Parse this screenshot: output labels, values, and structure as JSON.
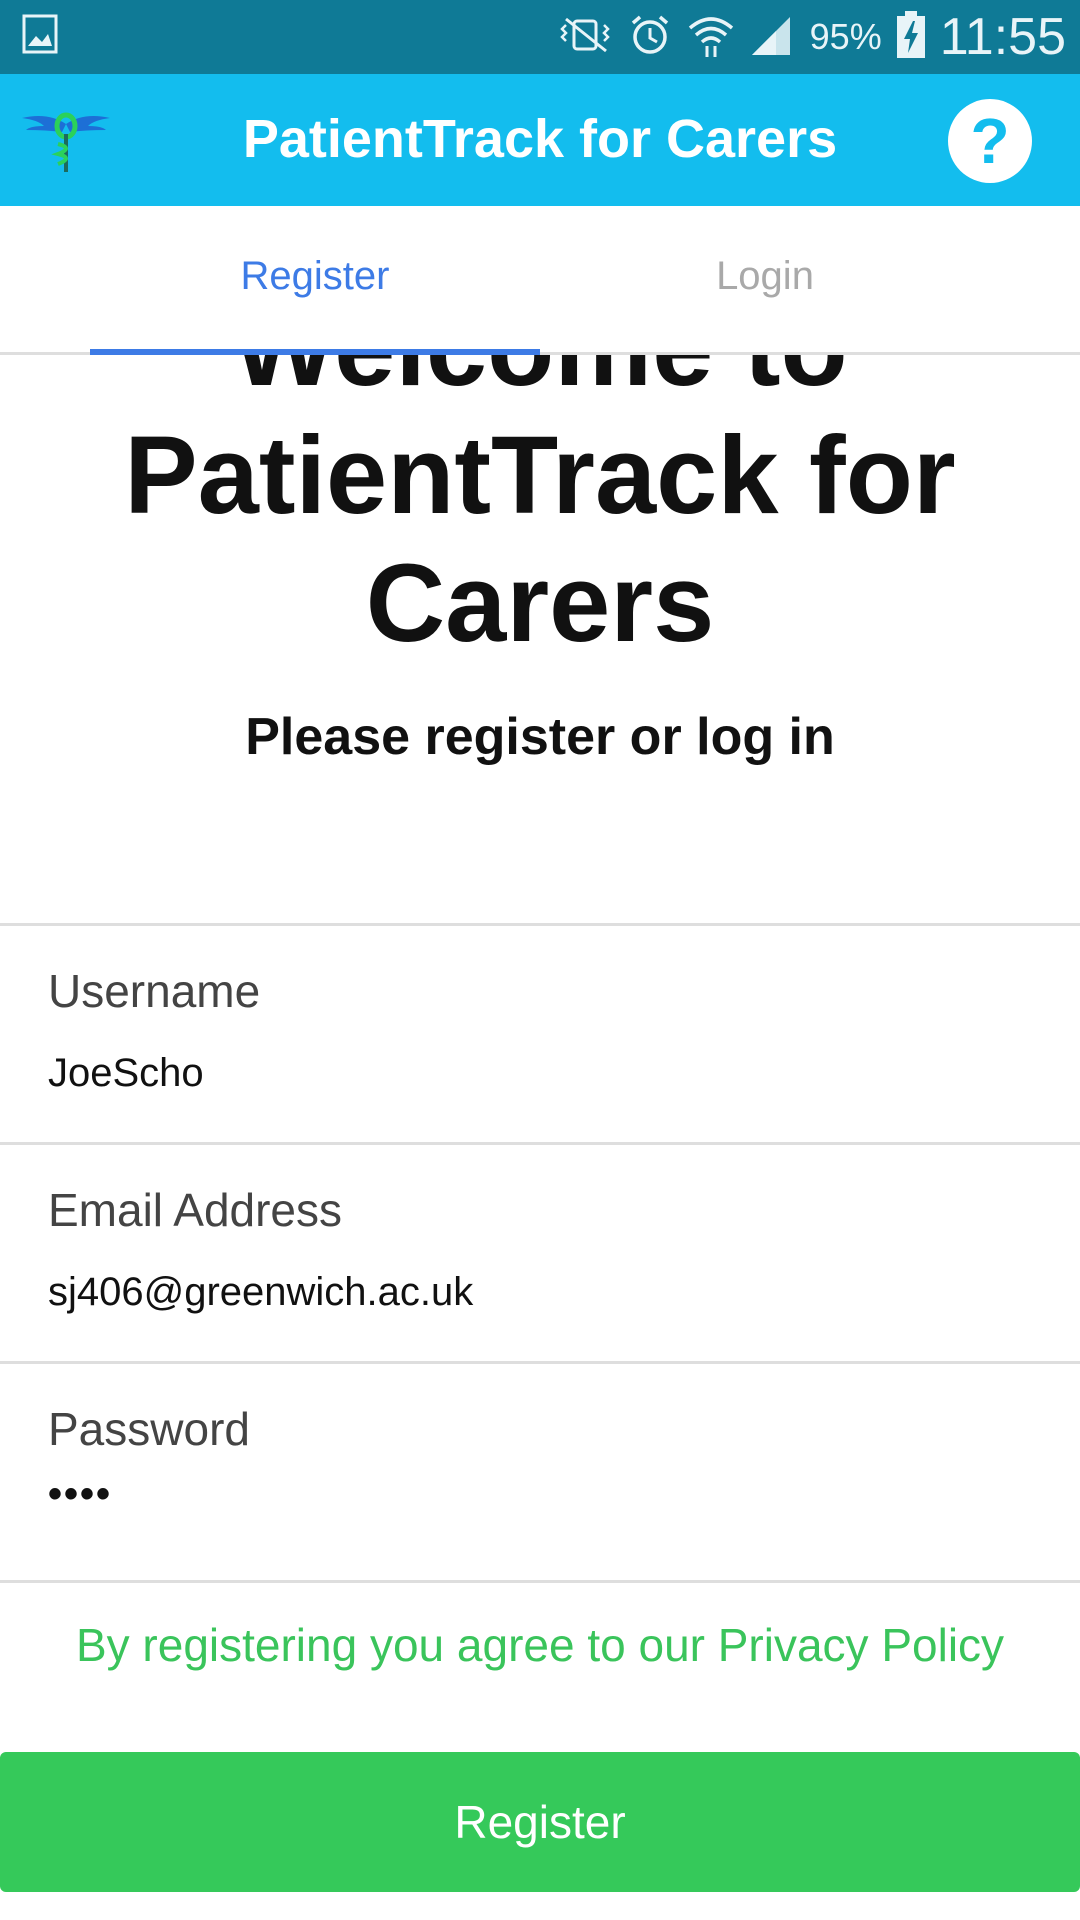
{
  "status_bar": {
    "battery_text": "95%",
    "time": "11:55",
    "icons": [
      "image-icon",
      "vibrate-icon",
      "alarm-icon",
      "wifi-icon",
      "signal-icon",
      "battery-charging-icon"
    ]
  },
  "app_bar": {
    "title": "PatientTrack for Carers",
    "help_label": "?",
    "logo_icon": "caduceus-logo-icon",
    "colors": {
      "background": "#13bdee",
      "title": "#ffffff"
    }
  },
  "tabs": [
    {
      "label": "Register",
      "active": true
    },
    {
      "label": "Login",
      "active": false
    }
  ],
  "welcome": {
    "title": "Welcome to PatientTrack for Carers",
    "subtitle": "Please register or log in"
  },
  "form": {
    "username": {
      "label": "Username",
      "value": "JoeScho"
    },
    "email": {
      "label": "Email Address",
      "value": "sj406@greenwich.ac.uk"
    },
    "password": {
      "label": "Password",
      "value": "••••"
    }
  },
  "privacy_text": "By registering you agree to our Privacy Policy",
  "register_button": "Register",
  "colors": {
    "accent": "#3d7be6",
    "green": "#35c95a",
    "status_bar": "#0f7a96"
  }
}
